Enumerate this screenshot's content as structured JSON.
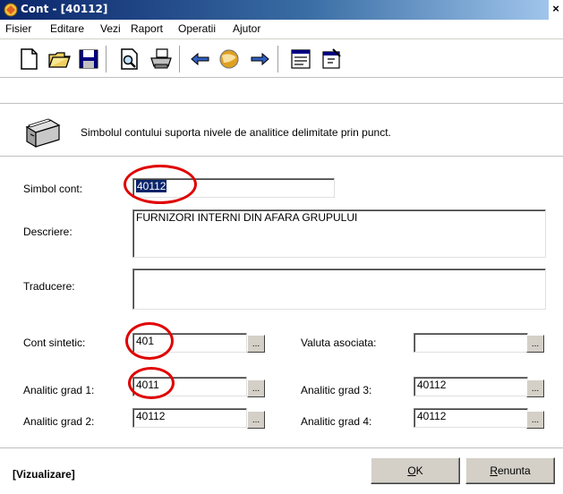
{
  "window": {
    "title": "Cont - [40112]",
    "close_glyph": "×"
  },
  "menu": [
    "Fisier",
    "Editare",
    "Vezi",
    "Raport",
    "Operatii",
    "Ajutor"
  ],
  "toolbar_icons": [
    "new-document-icon",
    "open-folder-icon",
    "save-icon",
    "print-preview-icon",
    "print-icon",
    "arrow-left-icon",
    "globe-icon",
    "arrow-right-icon",
    "list-view-icon",
    "properties-icon"
  ],
  "info": {
    "text": "Simbolul contului suporta nivele de analitice delimitate prin punct."
  },
  "form": {
    "simbol_label": "Simbol cont:",
    "simbol_value": "40112",
    "descriere_label": "Descriere:",
    "descriere_value": "FURNIZORI INTERNI DIN AFARA GRUPULUI",
    "traducere_label": "Traducere:",
    "traducere_value": "",
    "sintetic_label": "Cont sintetic:",
    "sintetic_value": "401",
    "valuta_label": "Valuta asociata:",
    "valuta_value": "",
    "grad1_label": "Analitic grad 1:",
    "grad1_value": "4011",
    "grad2_label": "Analitic grad 2:",
    "grad2_value": "40112",
    "grad3_label": "Analitic grad 3:",
    "grad3_value": "40112",
    "grad4_label": "Analitic grad 4:",
    "grad4_value": "40112",
    "browse_glyph": "..."
  },
  "status": {
    "mode": "[Vizualizare]",
    "ok_label": "K",
    "ok_underline": "O",
    "cancel_label": "enunta",
    "cancel_underline": "R"
  },
  "colors": {
    "highlight": "#e00000",
    "title_bar": "#0a246a",
    "selection": "#0a246a"
  }
}
